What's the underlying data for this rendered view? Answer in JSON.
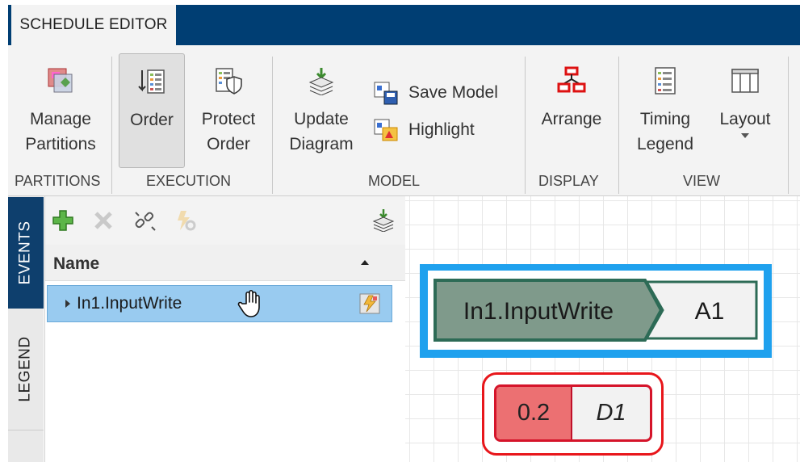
{
  "app": {
    "tab_label": "SCHEDULE EDITOR"
  },
  "ribbon": {
    "partitions": {
      "section_label": "PARTITIONS",
      "manage_line1": "Manage",
      "manage_line2": "Partitions"
    },
    "execution": {
      "section_label": "EXECUTION",
      "order_label": "Order",
      "protect_line1": "Protect",
      "protect_line2": "Order"
    },
    "model": {
      "section_label": "MODEL",
      "update_line1": "Update",
      "update_line2": "Diagram",
      "save_model_label": "Save Model",
      "highlight_label": "Highlight"
    },
    "display": {
      "section_label": "DISPLAY",
      "arrange_label": "Arrange"
    },
    "view": {
      "section_label": "VIEW",
      "timing_line1": "Timing",
      "timing_line2": "Legend",
      "layout_label": "Layout"
    }
  },
  "side_tabs": {
    "events": "EVENTS",
    "legend": "LEGEND"
  },
  "events_panel": {
    "column_header": "Name",
    "rows": [
      {
        "label": "In1.InputWrite"
      }
    ]
  },
  "diagram": {
    "event_block": {
      "name": "In1.InputWrite",
      "partition": "A1"
    },
    "discrete_block": {
      "rate": "0.2",
      "partition": "D1"
    }
  },
  "colors": {
    "title_strip": "#003e73",
    "selection": "#1fa1ee",
    "event_block_fill": "#7f9a8b",
    "event_block_border": "#2d6b56",
    "rate_fill": "#ec7072",
    "highlight_border": "#e8161b"
  }
}
